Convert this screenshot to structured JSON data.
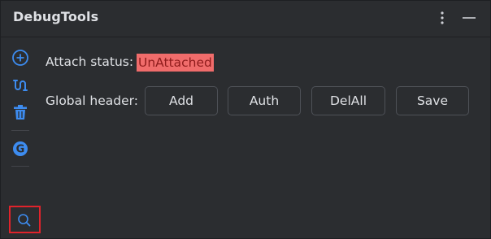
{
  "window": {
    "title": "DebugTools",
    "more_icon": "more-vertical-icon",
    "minimize_icon": "minimize-icon"
  },
  "toolstrip": {
    "items": [
      {
        "icon": "add-circle-icon"
      },
      {
        "icon": "connect-icon"
      },
      {
        "icon": "trash-icon"
      },
      {
        "icon": "groovy-icon"
      },
      {
        "icon": "search-icon"
      }
    ],
    "highlight_color": "#e0232b",
    "icon_color": "#3d8cf0"
  },
  "attach": {
    "label": "Attach status:",
    "status": "UnAttached",
    "status_bg": "#f06c6b"
  },
  "global_header": {
    "label": "Global header:",
    "buttons": [
      {
        "label": "Add"
      },
      {
        "label": "Auth"
      },
      {
        "label": "DelAll"
      },
      {
        "label": "Save"
      }
    ]
  }
}
